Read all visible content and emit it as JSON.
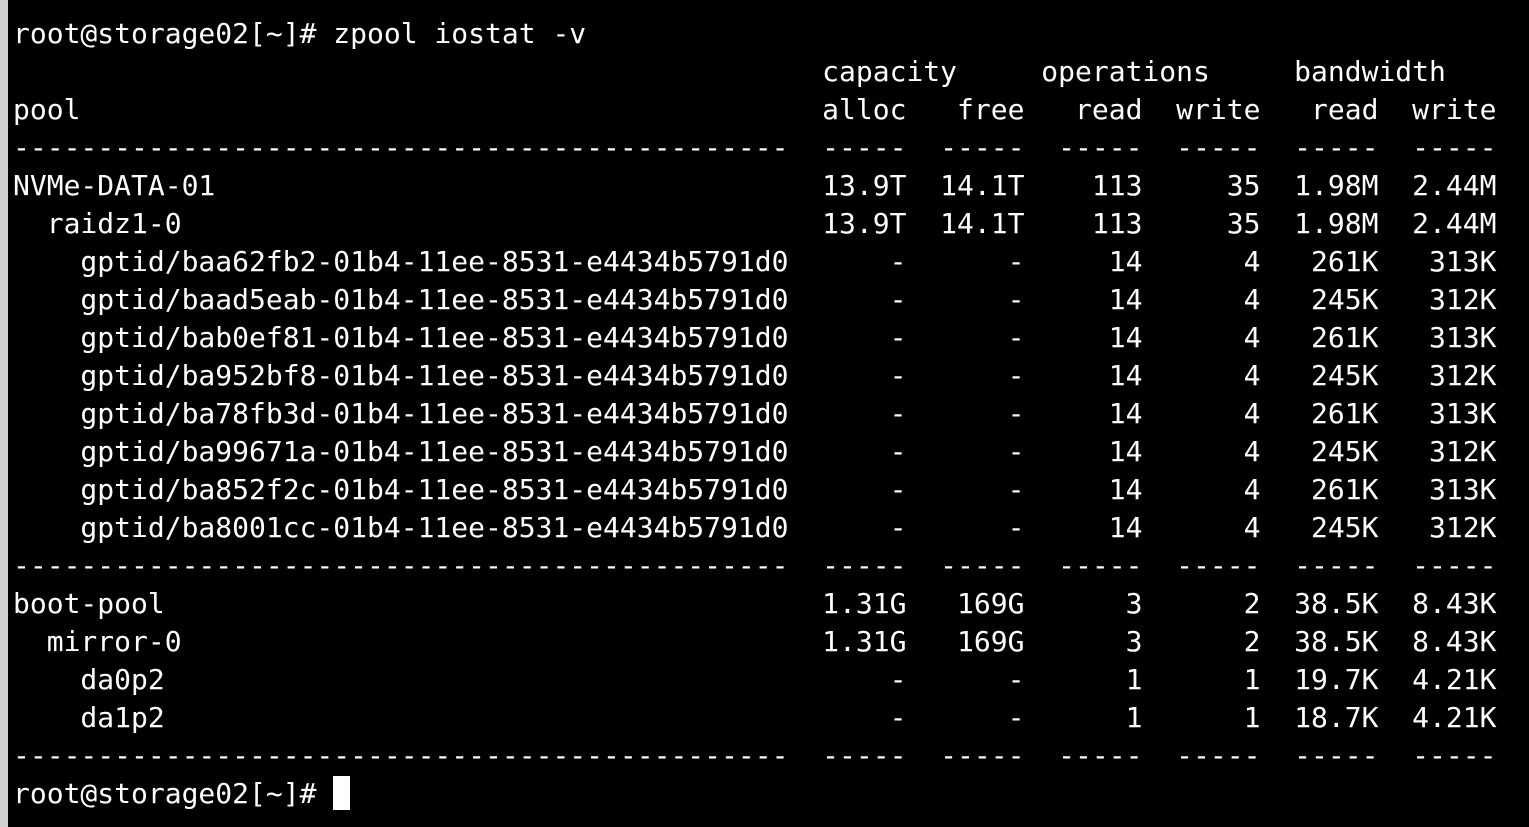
{
  "terminal": {
    "command_line": "root@storage02[~]# zpool iostat -v",
    "header_line_1": "                                                capacity     operations     bandwidth",
    "header_line_2": "pool                                            alloc   free   read  write   read  write",
    "separator": "----------------------------------------------  -----  -----  -----  -----  -----  -----",
    "rows": [
      "NVMe-DATA-01                                    13.9T  14.1T    113     35  1.98M  2.44M",
      "  raidz1-0                                      13.9T  14.1T    113     35  1.98M  2.44M",
      "    gptid/baa62fb2-01b4-11ee-8531-e4434b5791d0      -      -     14      4   261K   313K",
      "    gptid/baad5eab-01b4-11ee-8531-e4434b5791d0      -      -     14      4   245K   312K",
      "    gptid/bab0ef81-01b4-11ee-8531-e4434b5791d0      -      -     14      4   261K   313K",
      "    gptid/ba952bf8-01b4-11ee-8531-e4434b5791d0      -      -     14      4   245K   312K",
      "    gptid/ba78fb3d-01b4-11ee-8531-e4434b5791d0      -      -     14      4   261K   313K",
      "    gptid/ba99671a-01b4-11ee-8531-e4434b5791d0      -      -     14      4   245K   312K",
      "    gptid/ba852f2c-01b4-11ee-8531-e4434b5791d0      -      -     14      4   261K   313K",
      "    gptid/ba8001cc-01b4-11ee-8531-e4434b5791d0      -      -     14      4   245K   312K"
    ],
    "rows_boot": [
      "boot-pool                                       1.31G   169G      3      2  38.5K  8.43K",
      "  mirror-0                                      1.31G   169G      3      2  38.5K  8.43K",
      "    da0p2                                           -      -      1      1  19.7K  4.21K",
      "    da1p2                                           -      -      1      1  18.7K  4.21K"
    ],
    "prompt": "root@storage02[~]#"
  },
  "colors": {
    "background": "#000000",
    "foreground": "#ffffff"
  }
}
